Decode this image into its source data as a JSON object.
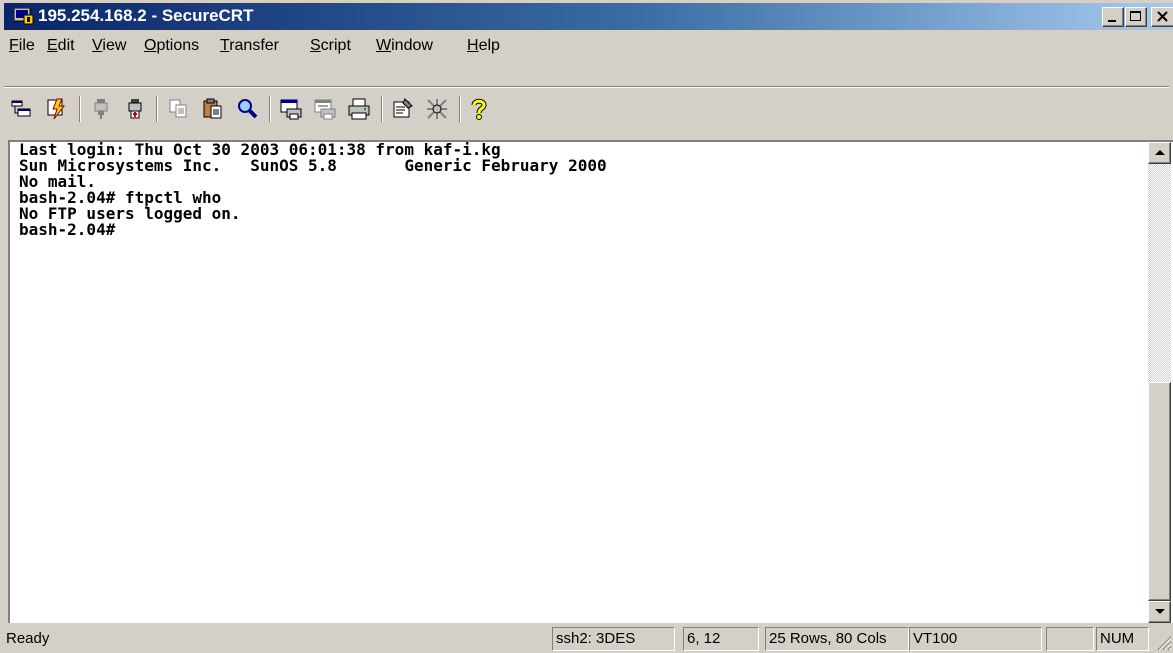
{
  "window": {
    "title": "195.254.168.2 - SecureCRT"
  },
  "menu": {
    "items": [
      {
        "pre": "",
        "key": "F",
        "post": "ile"
      },
      {
        "pre": "",
        "key": "E",
        "post": "dit"
      },
      {
        "pre": "",
        "key": "V",
        "post": "iew"
      },
      {
        "pre": "",
        "key": "O",
        "post": "ptions"
      },
      {
        "pre": "",
        "key": "T",
        "post": "ransfer"
      },
      {
        "pre": "",
        "key": "S",
        "post": "cript"
      },
      {
        "pre": "",
        "key": "W",
        "post": "indow"
      },
      {
        "pre": "",
        "key": "H",
        "post": "elp"
      }
    ]
  },
  "toolbar": {
    "icons": [
      "connect-icon",
      "quick-connect-icon",
      "connect-in-tab-icon",
      "disconnect-icon",
      "copy-icon",
      "paste-icon",
      "find-icon",
      "print-screen-icon",
      "print-selection-icon",
      "print-icon",
      "session-options-icon",
      "global-options-icon",
      "help-icon"
    ]
  },
  "terminal": {
    "lines": [
      "Last login: Thu Oct 30 2003 06:01:38 from kaf-i.kg",
      "Sun Microsystems Inc.   SunOS 5.8       Generic February 2000",
      "No mail.",
      "bash-2.04# ftpctl who",
      "No FTP users logged on.",
      "bash-2.04#"
    ]
  },
  "status": {
    "ready": "Ready",
    "cipher": "ssh2: 3DES",
    "cursor": "6, 12",
    "size": "25 Rows, 80 Cols",
    "emulation": "VT100",
    "caps": "",
    "num": "NUM"
  },
  "colors": {
    "titlebar_start": "#0a246a",
    "titlebar_end": "#a6caf0",
    "chrome": "#d4d0c8"
  }
}
